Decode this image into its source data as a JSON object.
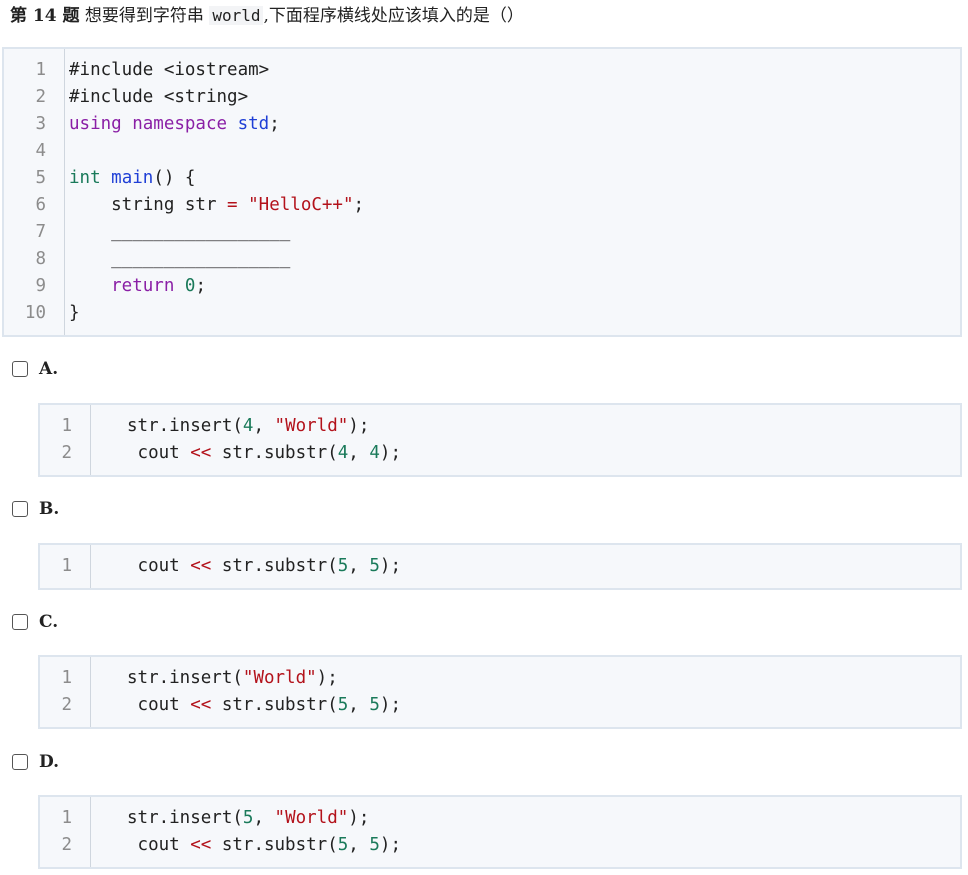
{
  "question": {
    "number_label": "第 14 题",
    "text_before": "想要得到字符串",
    "inline_code": "world",
    "text_after": ",下面程序横线处应该填入的是（）"
  },
  "main_code": {
    "lines": [
      {
        "num": "1",
        "tokens": [
          {
            "t": "#include <iostream>",
            "c": ""
          }
        ]
      },
      {
        "num": "2",
        "tokens": [
          {
            "t": "#include <string>",
            "c": ""
          }
        ]
      },
      {
        "num": "3",
        "tokens": [
          {
            "t": "using namespace ",
            "c": "kw-purple"
          },
          {
            "t": "std",
            "c": "kw-blue"
          },
          {
            "t": ";",
            "c": ""
          }
        ]
      },
      {
        "num": "4",
        "tokens": []
      },
      {
        "num": "5",
        "tokens": [
          {
            "t": "int ",
            "c": "kw-green"
          },
          {
            "t": "main",
            "c": "kw-blue"
          },
          {
            "t": "() {",
            "c": ""
          }
        ]
      },
      {
        "num": "6",
        "tokens": [
          {
            "t": "    string str ",
            "c": ""
          },
          {
            "t": "=",
            "c": "op"
          },
          {
            "t": " ",
            "c": ""
          },
          {
            "t": "\"HelloC++\"",
            "c": "str"
          },
          {
            "t": ";",
            "c": ""
          }
        ]
      },
      {
        "num": "7",
        "tokens": [
          {
            "t": "    _________________",
            "c": ""
          }
        ]
      },
      {
        "num": "8",
        "tokens": [
          {
            "t": "    _________________",
            "c": ""
          }
        ]
      },
      {
        "num": "9",
        "tokens": [
          {
            "t": "    return ",
            "c": "kw-purple"
          },
          {
            "t": "0",
            "c": "num"
          },
          {
            "t": ";",
            "c": ""
          }
        ]
      },
      {
        "num": "10",
        "tokens": [
          {
            "t": "}",
            "c": ""
          }
        ]
      }
    ]
  },
  "options": [
    {
      "letter": "A.",
      "lines": [
        {
          "num": "1",
          "tokens": [
            {
              "t": "str.insert(",
              "c": ""
            },
            {
              "t": "4",
              "c": "num"
            },
            {
              "t": ", ",
              "c": ""
            },
            {
              "t": "\"World\"",
              "c": "str"
            },
            {
              "t": ");",
              "c": ""
            }
          ]
        },
        {
          "num": "2",
          "tokens": [
            {
              "t": " cout ",
              "c": ""
            },
            {
              "t": "<<",
              "c": "op"
            },
            {
              "t": " str.substr(",
              "c": ""
            },
            {
              "t": "4",
              "c": "num"
            },
            {
              "t": ", ",
              "c": ""
            },
            {
              "t": "4",
              "c": "num"
            },
            {
              "t": ");",
              "c": ""
            }
          ]
        }
      ]
    },
    {
      "letter": "B.",
      "lines": [
        {
          "num": "1",
          "tokens": [
            {
              "t": " cout ",
              "c": ""
            },
            {
              "t": "<<",
              "c": "op"
            },
            {
              "t": " str.substr(",
              "c": ""
            },
            {
              "t": "5",
              "c": "num"
            },
            {
              "t": ", ",
              "c": ""
            },
            {
              "t": "5",
              "c": "num"
            },
            {
              "t": ");",
              "c": ""
            }
          ]
        }
      ]
    },
    {
      "letter": "C.",
      "lines": [
        {
          "num": "1",
          "tokens": [
            {
              "t": "str.insert(",
              "c": ""
            },
            {
              "t": "\"World\"",
              "c": "str"
            },
            {
              "t": ");",
              "c": ""
            }
          ]
        },
        {
          "num": "2",
          "tokens": [
            {
              "t": " cout ",
              "c": ""
            },
            {
              "t": "<<",
              "c": "op"
            },
            {
              "t": " str.substr(",
              "c": ""
            },
            {
              "t": "5",
              "c": "num"
            },
            {
              "t": ", ",
              "c": ""
            },
            {
              "t": "5",
              "c": "num"
            },
            {
              "t": ");",
              "c": ""
            }
          ]
        }
      ]
    },
    {
      "letter": "D.",
      "lines": [
        {
          "num": "1",
          "tokens": [
            {
              "t": "str.insert(",
              "c": ""
            },
            {
              "t": "5",
              "c": "num"
            },
            {
              "t": ", ",
              "c": ""
            },
            {
              "t": "\"World\"",
              "c": "str"
            },
            {
              "t": ");",
              "c": ""
            }
          ]
        },
        {
          "num": "2",
          "tokens": [
            {
              "t": " cout ",
              "c": ""
            },
            {
              "t": "<<",
              "c": "op"
            },
            {
              "t": " str.substr(",
              "c": ""
            },
            {
              "t": "5",
              "c": "num"
            },
            {
              "t": ", ",
              "c": ""
            },
            {
              "t": "5",
              "c": "num"
            },
            {
              "t": ");",
              "c": ""
            }
          ]
        }
      ]
    }
  ]
}
